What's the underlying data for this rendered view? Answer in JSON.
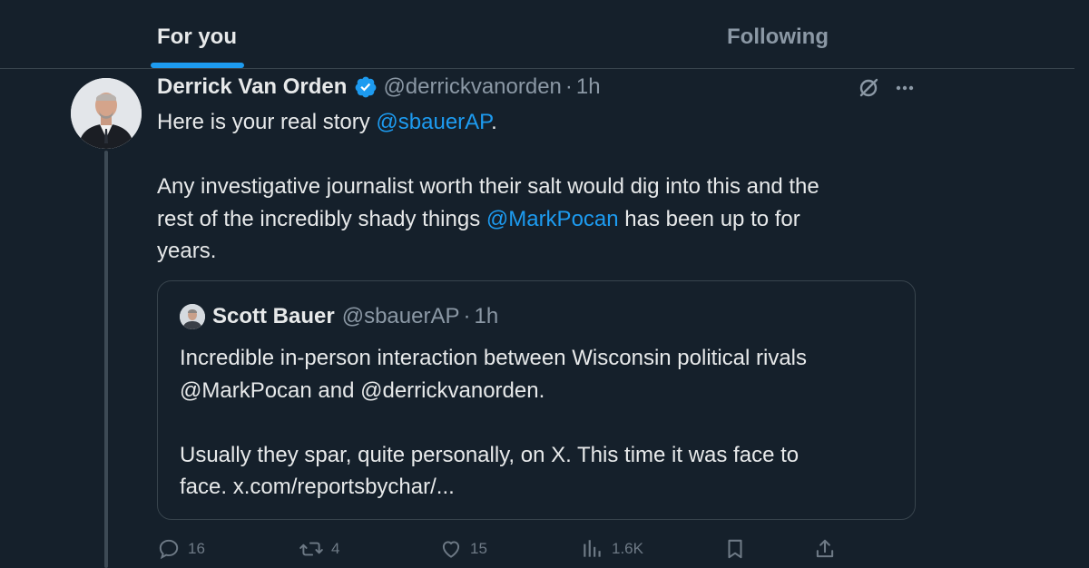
{
  "tabs": {
    "for_you": "For you",
    "following": "Following"
  },
  "tweet": {
    "display_name": "Derrick Van Orden",
    "handle": "@derrickvanorden",
    "separator": "·",
    "time": "1h",
    "verified": true,
    "text_line1_prefix": "Here is your real story ",
    "text_line1_mention": "@sbauerAP",
    "text_line1_suffix": ".",
    "text_line2_a": "Any investigative journalist worth their salt would dig into this and the",
    "text_line2_b_prefix": "rest of the incredibly shady things ",
    "text_line2_b_mention": "@MarkPocan",
    "text_line2_b_suffix": " has been up to for",
    "text_line2_c": "years.",
    "icons": {
      "grok": "grok-icon",
      "more": "more-icon"
    }
  },
  "quote": {
    "display_name": "Scott Bauer",
    "handle": "@sbauerAP",
    "separator": "·",
    "time": "1h",
    "line1": "Incredible in-person interaction between Wisconsin political rivals",
    "line2": "@MarkPocan and @derrickvanorden.",
    "line3": "Usually they spar, quite personally, on X. This time it was face to",
    "line4": "face. x.com/reportsbychar/..."
  },
  "actions": {
    "replies": "16",
    "reposts": "4",
    "likes": "15",
    "views": "1.6K"
  },
  "colors": {
    "background": "#15202b",
    "accent": "#1d9bf0",
    "text": "#e7e9ea",
    "muted": "#8b98a5",
    "border": "#38444d"
  }
}
